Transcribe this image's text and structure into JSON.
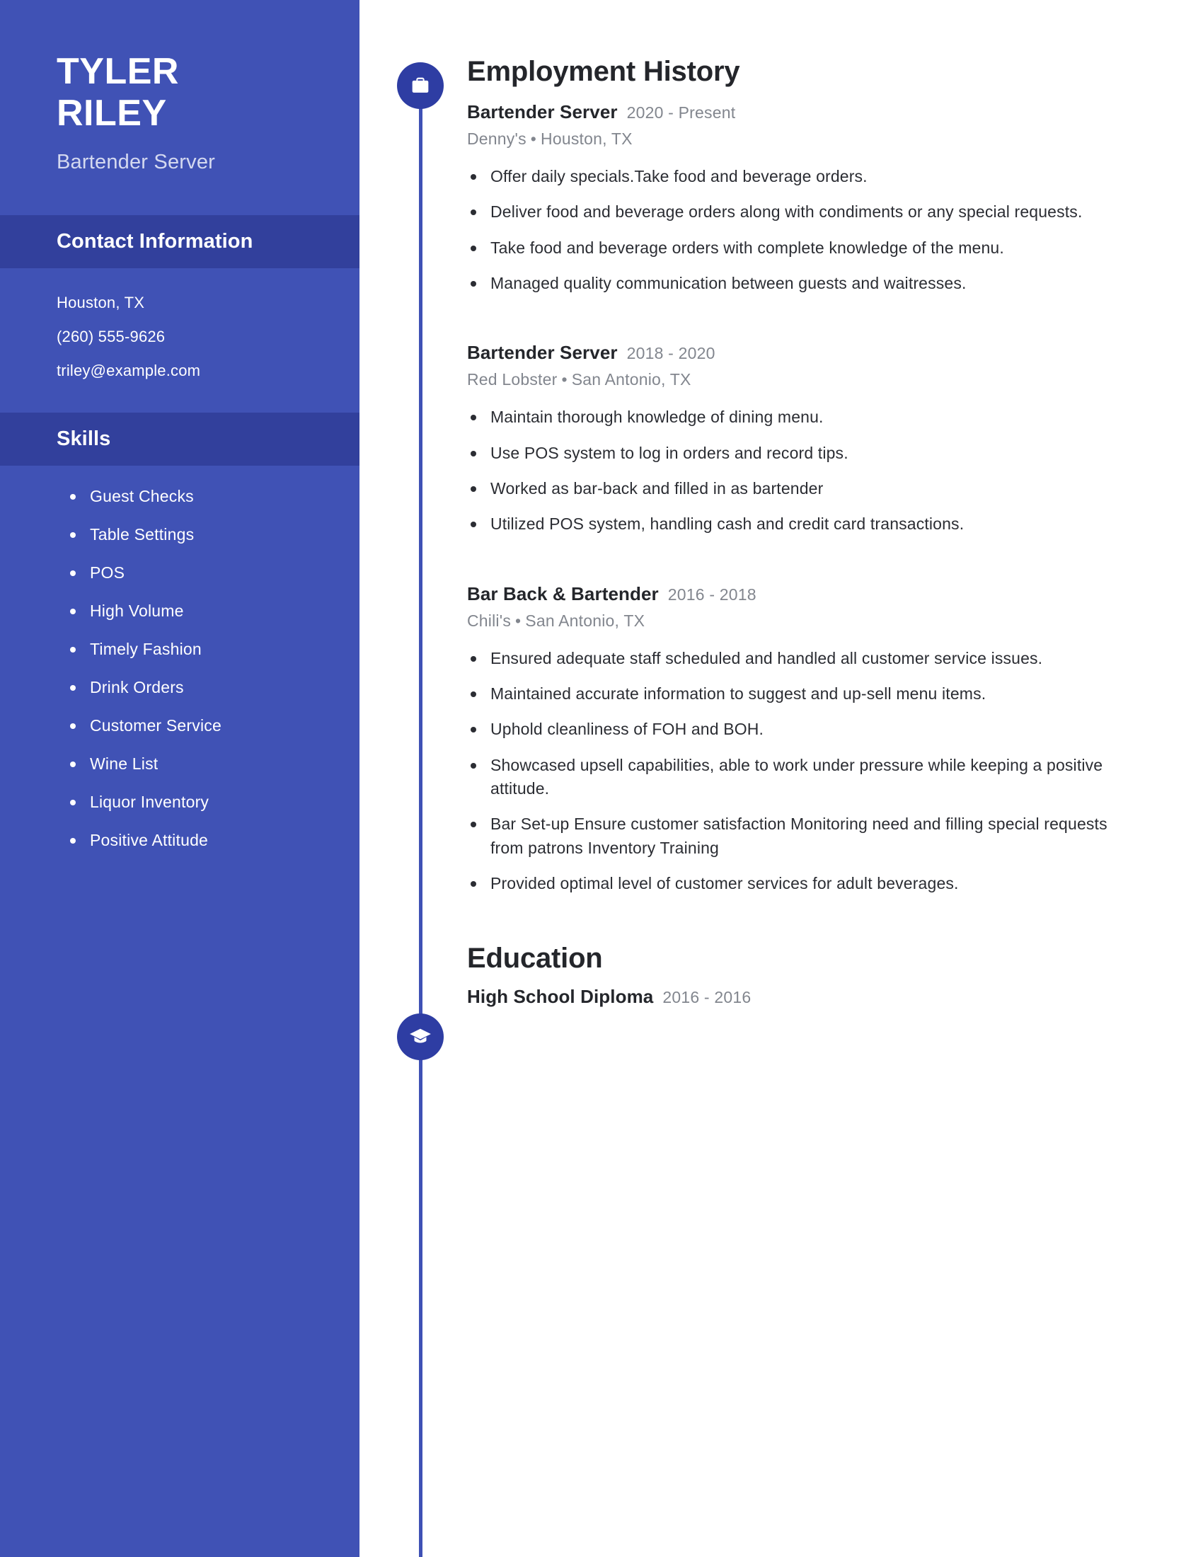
{
  "theme": {
    "sidebar_bg": "#4052b5",
    "sidebar_header_bg": "#32409c",
    "accent": "#3f51b5",
    "marker_bg": "#2e3da3",
    "text_dark": "#24262b",
    "text_muted": "#82868e"
  },
  "sidebar": {
    "first_name": "TYLER",
    "last_name": "RILEY",
    "job_title": "Bartender Server",
    "contact_header": "Contact Information",
    "contact": [
      "Houston, TX",
      "(260) 555-9626",
      "triley@example.com"
    ],
    "skills_header": "Skills",
    "skills": [
      "Guest Checks",
      "Table Settings",
      "POS",
      "High Volume",
      "Timely Fashion",
      "Drink Orders",
      "Customer Service",
      "Wine List",
      "Liquor Inventory",
      "Positive Attitude"
    ]
  },
  "employment": {
    "title": "Employment History",
    "icon": "briefcase-icon",
    "entries": [
      {
        "role": "Bartender Server",
        "dates": "2020 - Present",
        "company": "Denny's",
        "location": "Houston, TX",
        "bullets": [
          "Offer daily specials.Take food and beverage orders.",
          "Deliver food and beverage orders along with condiments or any special requests.",
          "Take food and beverage orders with complete knowledge of the menu.",
          "Managed quality communication between guests and waitresses."
        ]
      },
      {
        "role": "Bartender Server",
        "dates": "2018 - 2020",
        "company": "Red Lobster",
        "location": "San Antonio, TX",
        "bullets": [
          "Maintain thorough knowledge of dining menu.",
          "Use POS system to log in orders and record tips.",
          "Worked as bar-back and filled in as bartender",
          "Utilized POS system, handling cash and credit card transactions."
        ]
      },
      {
        "role": "Bar Back & Bartender",
        "dates": "2016 - 2018",
        "company": "Chili's",
        "location": "San Antonio, TX",
        "bullets": [
          "Ensured adequate staff scheduled and handled all customer service issues.",
          "Maintained accurate information to suggest and up-sell menu items.",
          "Uphold cleanliness of FOH and BOH.",
          "Showcased upsell capabilities, able to work under pressure while keeping a positive attitude.",
          "Bar Set-up Ensure customer satisfaction Monitoring need and filling special requests from patrons Inventory Training",
          "Provided optimal level of customer services for adult beverages."
        ]
      }
    ]
  },
  "education": {
    "title": "Education",
    "icon": "graduation-cap-icon",
    "entries": [
      {
        "degree": "High School Diploma",
        "dates": "2016 - 2016"
      }
    ]
  },
  "separator": "•"
}
